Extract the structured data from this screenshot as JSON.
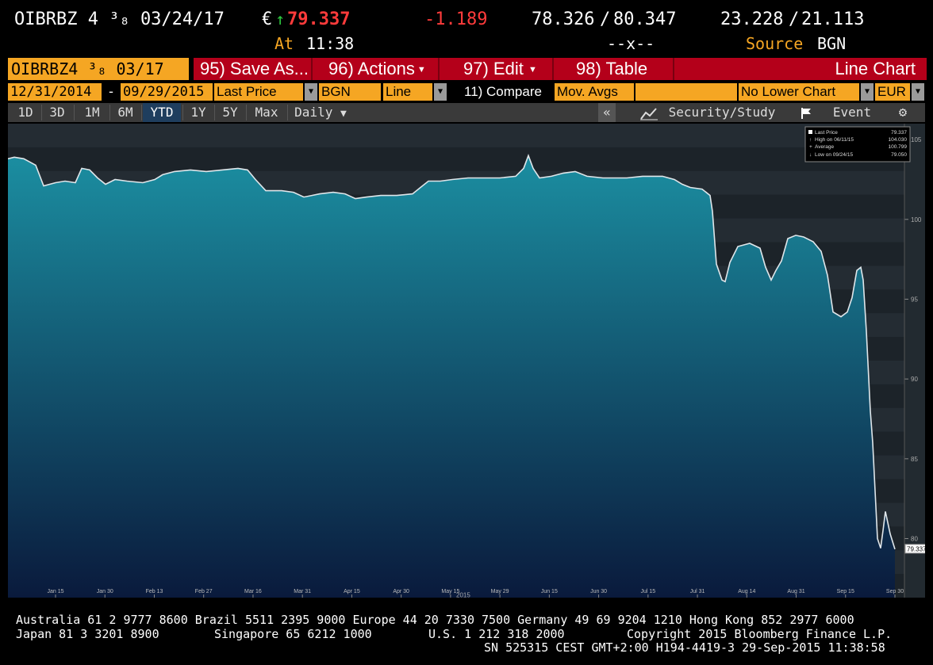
{
  "header": {
    "security": "OIBRBZ 4 ³₈ 03/24/17",
    "currency": "€",
    "last_price": "79.337",
    "change": "-1.189",
    "bid": "78.326",
    "ask": "80.347",
    "yield_bid": "23.228",
    "yield_ask": "21.113",
    "time_label": "At",
    "time": "11:38",
    "mid_marker": "--x--",
    "source_label": "Source",
    "source": "BGN"
  },
  "command_bar": {
    "ticker": "OIBRBZ4 ³₈ 03/17",
    "save_as": "95) Save As...",
    "actions": "96) Actions",
    "edit": "97) Edit",
    "table": "98) Table",
    "chart_type": "Line Chart"
  },
  "field_bar": {
    "start_date": "12/31/2014",
    "dash": "-",
    "end_date": "09/29/2015",
    "field": "Last Price",
    "source": "BGN",
    "style": "Line",
    "compare": "11) Compare",
    "mov_avgs": "Mov. Avgs",
    "lower_chart": "No Lower Chart",
    "currency": "EUR"
  },
  "range_bar": {
    "ranges": [
      "1D",
      "3D",
      "1M",
      "6M",
      "YTD",
      "1Y",
      "5Y",
      "Max"
    ],
    "active": "YTD",
    "frequency": "Daily",
    "collapse": "«",
    "security_study": "Security/Study",
    "event": "Event"
  },
  "legend": {
    "last_price_label": "Last Price",
    "last_price": "79.337",
    "high_label": "High on 06/11/15",
    "high": "104.030",
    "average_label": "Average",
    "average": "100.799",
    "low_label": "Low on 09/24/15",
    "low": "79.050"
  },
  "chart_data": {
    "type": "area",
    "title": "",
    "xlabel": "",
    "ylabel": "",
    "x_ticks": [
      "Jan 15",
      "Jan 30",
      "Feb 13",
      "Feb 27",
      "Mar 16",
      "Mar 31",
      "Apr 15",
      "Apr 30",
      "May 15",
      "May 29",
      "Jun 15",
      "Jun 30",
      "Jul 15",
      "Jul 31",
      "Aug 14",
      "Aug 31",
      "Sep 15",
      "Sep 30"
    ],
    "x_year_label": "2015",
    "y_ticks": [
      80,
      85,
      90,
      95,
      100,
      105
    ],
    "ylim": [
      76.3,
      106
    ],
    "last_value_label": "79.337",
    "colors": {
      "fill_top": "#1b8ea1",
      "fill_bottom": "#0a1a3c",
      "line": "#dfe6ea",
      "background": "#222a30"
    },
    "series": [
      {
        "values": [
          [
            0,
            103.8
          ],
          [
            8,
            103.9
          ],
          [
            20,
            103.8
          ],
          [
            35,
            103.4
          ],
          [
            45,
            102.1
          ],
          [
            60,
            102.3
          ],
          [
            72,
            102.4
          ],
          [
            85,
            102.3
          ],
          [
            93,
            103.2
          ],
          [
            103,
            103.1
          ],
          [
            113,
            102.6
          ],
          [
            123,
            102.2
          ],
          [
            135,
            102.5
          ],
          [
            150,
            102.4
          ],
          [
            170,
            102.3
          ],
          [
            185,
            102.5
          ],
          [
            195,
            102.8
          ],
          [
            210,
            103.0
          ],
          [
            230,
            103.1
          ],
          [
            250,
            103.0
          ],
          [
            270,
            103.1
          ],
          [
            290,
            103.2
          ],
          [
            302,
            103.1
          ],
          [
            312,
            102.5
          ],
          [
            325,
            101.8
          ],
          [
            345,
            101.8
          ],
          [
            360,
            101.7
          ],
          [
            373,
            101.4
          ],
          [
            383,
            101.5
          ],
          [
            393,
            101.6
          ],
          [
            410,
            101.7
          ],
          [
            425,
            101.6
          ],
          [
            438,
            101.3
          ],
          [
            452,
            101.4
          ],
          [
            470,
            101.5
          ],
          [
            490,
            101.5
          ],
          [
            510,
            101.6
          ],
          [
            520,
            102.0
          ],
          [
            530,
            102.4
          ],
          [
            545,
            102.4
          ],
          [
            560,
            102.5
          ],
          [
            580,
            102.6
          ],
          [
            600,
            102.6
          ],
          [
            620,
            102.6
          ],
          [
            640,
            102.7
          ],
          [
            650,
            103.2
          ],
          [
            656,
            104.0
          ],
          [
            662,
            103.2
          ],
          [
            670,
            102.6
          ],
          [
            685,
            102.7
          ],
          [
            700,
            102.9
          ],
          [
            715,
            103.0
          ],
          [
            730,
            102.7
          ],
          [
            750,
            102.6
          ],
          [
            780,
            102.6
          ],
          [
            800,
            102.7
          ],
          [
            825,
            102.7
          ],
          [
            840,
            102.5
          ],
          [
            850,
            102.2
          ],
          [
            860,
            102.0
          ],
          [
            875,
            101.9
          ],
          [
            885,
            101.5
          ],
          [
            888,
            100.5
          ],
          [
            893,
            97.2
          ],
          [
            900,
            96.2
          ],
          [
            904,
            96.1
          ],
          [
            910,
            97.3
          ],
          [
            920,
            98.3
          ],
          [
            935,
            98.5
          ],
          [
            948,
            98.2
          ],
          [
            955,
            97.0
          ],
          [
            962,
            96.2
          ],
          [
            968,
            96.8
          ],
          [
            975,
            97.4
          ],
          [
            983,
            98.8
          ],
          [
            993,
            99.0
          ],
          [
            1003,
            98.9
          ],
          [
            1015,
            98.6
          ],
          [
            1025,
            98.0
          ],
          [
            1033,
            96.5
          ],
          [
            1040,
            94.2
          ],
          [
            1050,
            93.9
          ],
          [
            1058,
            94.2
          ],
          [
            1064,
            95.1
          ],
          [
            1070,
            96.8
          ],
          [
            1075,
            97.0
          ],
          [
            1078,
            96.2
          ],
          [
            1082,
            93.0
          ],
          [
            1087,
            88.0
          ],
          [
            1090,
            86.0
          ],
          [
            1096,
            80.0
          ],
          [
            1100,
            79.4
          ],
          [
            1103,
            80.5
          ],
          [
            1106,
            81.7
          ],
          [
            1112,
            80.3
          ],
          [
            1118,
            79.337
          ]
        ]
      }
    ],
    "x_domain": [
      0,
      1130
    ]
  },
  "footer": {
    "line1": "Australia 61 2 9777 8600 Brazil 5511 2395 9000 Europe 44 20 7330 7500 Germany 49 69 9204 1210 Hong Kong 852 2977 6000",
    "line2_left": "Japan 81 3 3201 8900",
    "line2_mid": "Singapore 65 6212 1000",
    "line2_us": "U.S. 1 212 318 2000",
    "line2_right": "Copyright 2015 Bloomberg Finance L.P.",
    "line3": "SN 525315 CEST GMT+2:00 H194-4419-3 29-Sep-2015 11:38:58"
  }
}
